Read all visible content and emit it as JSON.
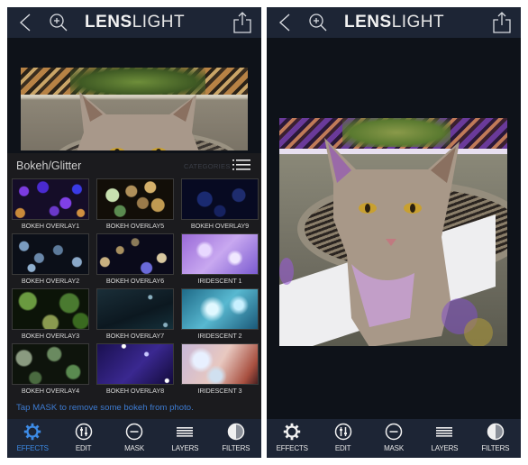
{
  "screens": [
    {
      "id": "left",
      "header": {
        "title_bold": "LENS",
        "title_light": "LIGHT",
        "back_icon": "chevron-left-icon",
        "zoom_icon": "zoom-in-icon",
        "share_icon": "share-icon"
      },
      "preview_image": {
        "description": "Cat photo preview (cropped)"
      },
      "effects_panel": {
        "category_title": "Bokeh/Glitter",
        "categories_label": "CATEGORIES",
        "categories_icon": "list-icon",
        "effects": [
          {
            "name": "BOKEH OVERLAY1",
            "thumb": "t1"
          },
          {
            "name": "BOKEH OVERLAY5",
            "thumb": "t5"
          },
          {
            "name": "BOKEH OVERLAY9",
            "thumb": "t9"
          },
          {
            "name": "BOKEH OVERLAY2",
            "thumb": "t2"
          },
          {
            "name": "BOKEH OVERLAY6",
            "thumb": "t6"
          },
          {
            "name": "IRIDESCENT 1",
            "thumb": "ti1"
          },
          {
            "name": "BOKEH OVERLAY3",
            "thumb": "t3"
          },
          {
            "name": "BOKEH OVERLAY7",
            "thumb": "t7"
          },
          {
            "name": "IRIDESCENT 2",
            "thumb": "ti2"
          },
          {
            "name": "BOKEH OVERLAY4",
            "thumb": "t4"
          },
          {
            "name": "BOKEH OVERLAY8",
            "thumb": "t8"
          },
          {
            "name": "IRIDESCENT 3",
            "thumb": "ti3"
          }
        ],
        "hint": "Tap MASK to remove some bokeh from photo."
      },
      "tabbar": {
        "active": "EFFECTS",
        "tabs": [
          {
            "label": "EFFECTS",
            "icon": "gear-icon"
          },
          {
            "label": "EDIT",
            "icon": "sliders-icon"
          },
          {
            "label": "MASK",
            "icon": "minus-circle-icon"
          },
          {
            "label": "LAYERS",
            "icon": "layers-icon"
          },
          {
            "label": "FILTERS",
            "icon": "half-circle-icon"
          }
        ]
      }
    },
    {
      "id": "right",
      "header": {
        "title_bold": "LENS",
        "title_light": "LIGHT",
        "back_icon": "chevron-left-icon",
        "zoom_icon": "zoom-in-icon",
        "share_icon": "share-icon"
      },
      "photo": {
        "description": "Edited cat photo with purple/gold bokeh overlay"
      },
      "tabbar": {
        "active": "",
        "tabs": [
          {
            "label": "EFFECTS",
            "icon": "gear-icon"
          },
          {
            "label": "EDIT",
            "icon": "sliders-icon"
          },
          {
            "label": "MASK",
            "icon": "minus-circle-icon"
          },
          {
            "label": "LAYERS",
            "icon": "layers-icon"
          },
          {
            "label": "FILTERS",
            "icon": "half-circle-icon"
          }
        ]
      }
    }
  ],
  "colors": {
    "bar_bg": "#1d2535",
    "screen_bg": "#0e1219",
    "panel_bg": "#1b1b1e",
    "accent_blue": "#3d8be6",
    "hint_blue": "#3d7bd1",
    "text_white": "#e8e8e8"
  }
}
